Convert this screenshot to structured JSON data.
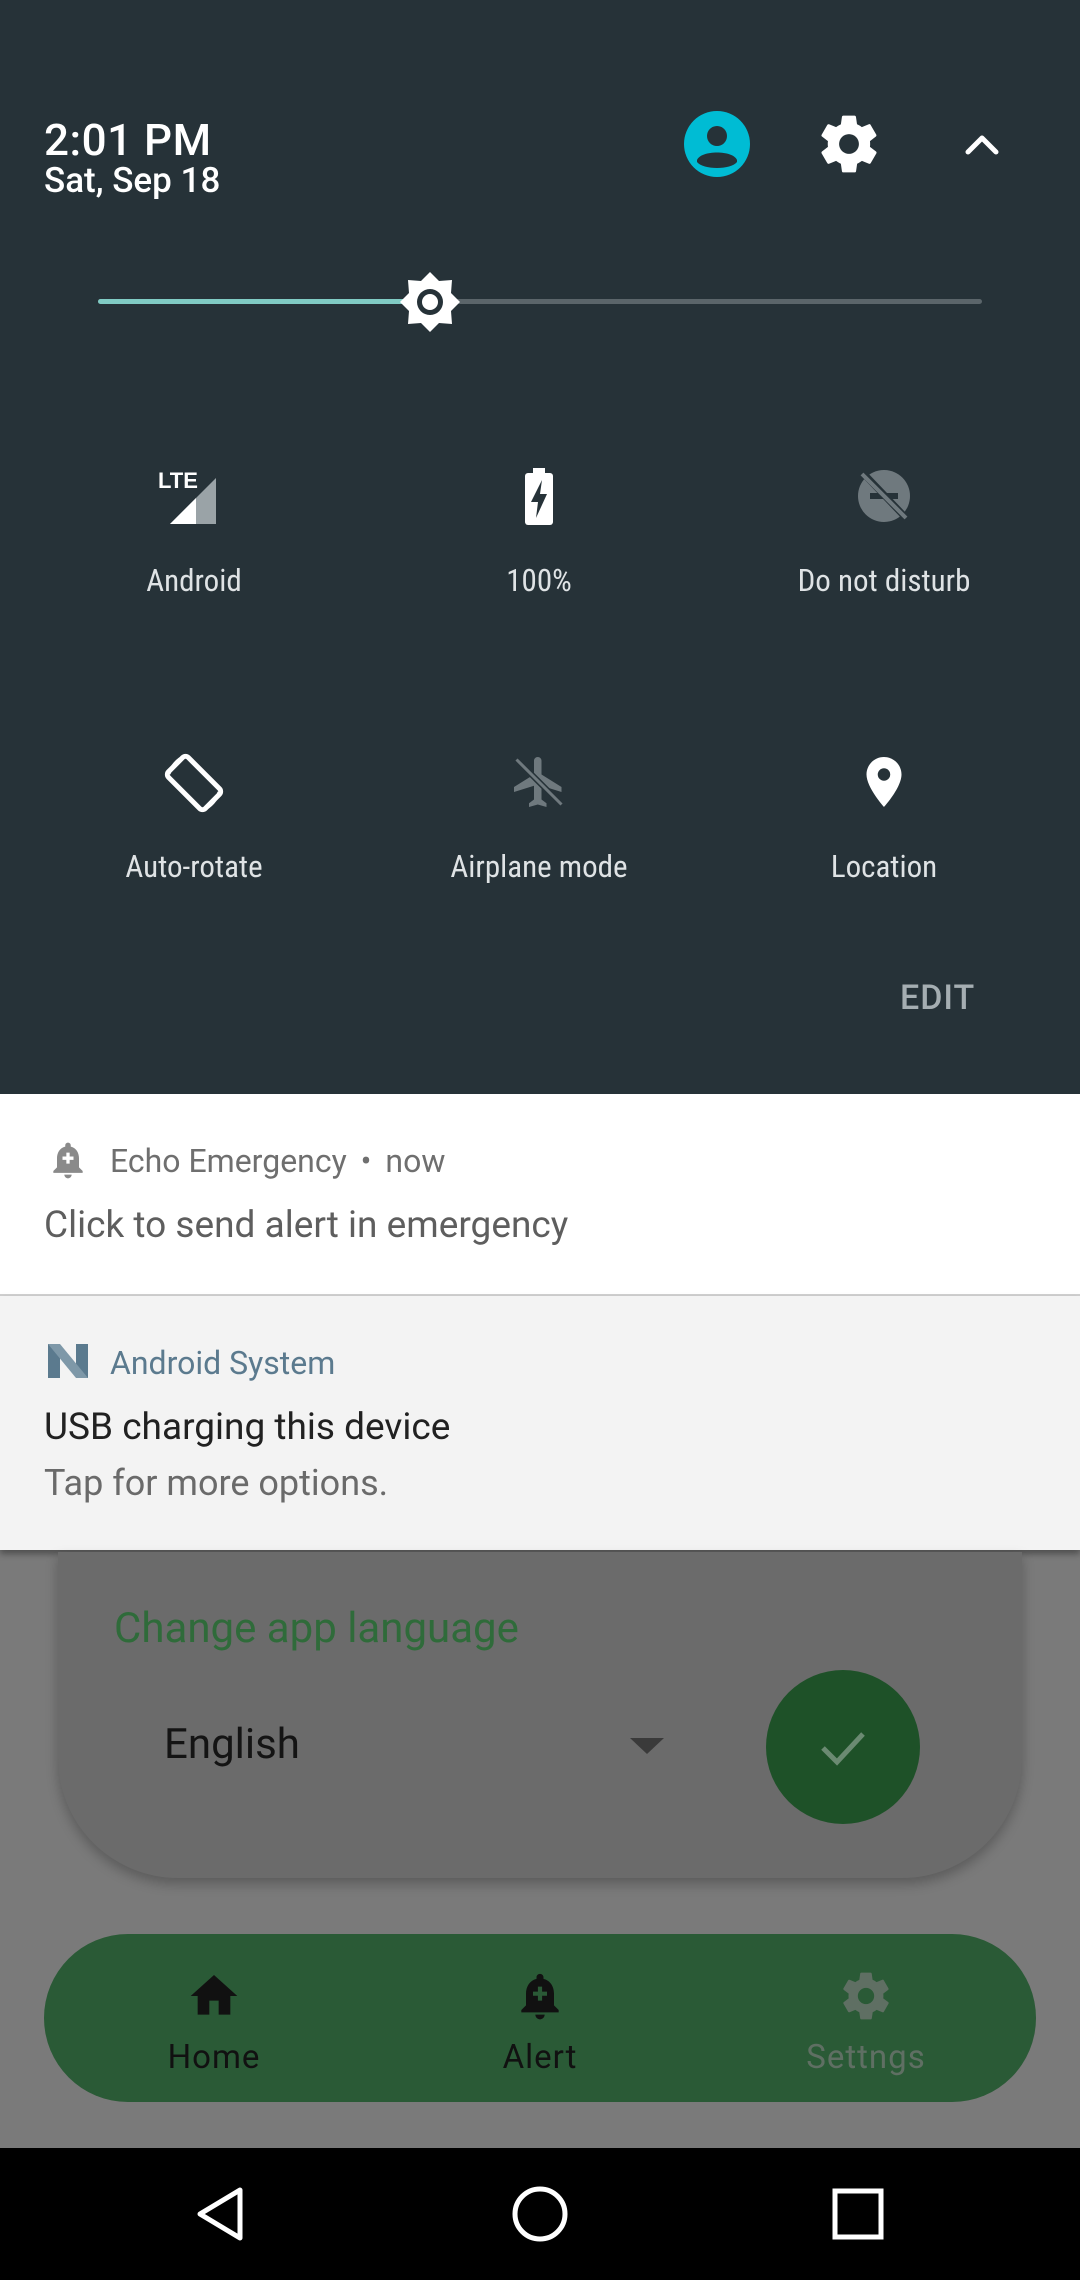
{
  "quick_settings": {
    "time": "2:01 PM",
    "date": "Sat, Sep 18",
    "brightness_level": 0.376,
    "tiles": {
      "network": {
        "label": "Android",
        "icon": "lte-signal-icon"
      },
      "battery": {
        "label": "100%",
        "icon": "battery-charging-icon"
      },
      "dnd": {
        "label": "Do not disturb",
        "icon": "do-not-disturb-off-icon"
      },
      "rotate": {
        "label": "Auto-rotate",
        "icon": "auto-rotate-icon"
      },
      "airplane": {
        "label": "Airplane mode",
        "icon": "airplane-off-icon"
      },
      "location": {
        "label": "Location",
        "icon": "location-pin-icon"
      }
    },
    "edit_label": "EDIT"
  },
  "notifications": [
    {
      "app": "Echo Emergency",
      "separator": "•",
      "time": "now",
      "text": "Click to send alert in emergency",
      "icon": "alert-bell-icon"
    },
    {
      "app": "Android System",
      "title": "USB charging this device",
      "text": "Tap for more options.",
      "icon": "android-n-icon"
    }
  ],
  "app": {
    "language_card": {
      "title": "Change app language",
      "selected": "English"
    },
    "nav": {
      "home": "Home",
      "alert": "Alert",
      "settings": "Settngs"
    }
  },
  "colors": {
    "shade_bg": "#263238",
    "accent_teal": "#80cbc4",
    "user_cyan": "#00bcd4",
    "app_green": "#2a5a36"
  }
}
